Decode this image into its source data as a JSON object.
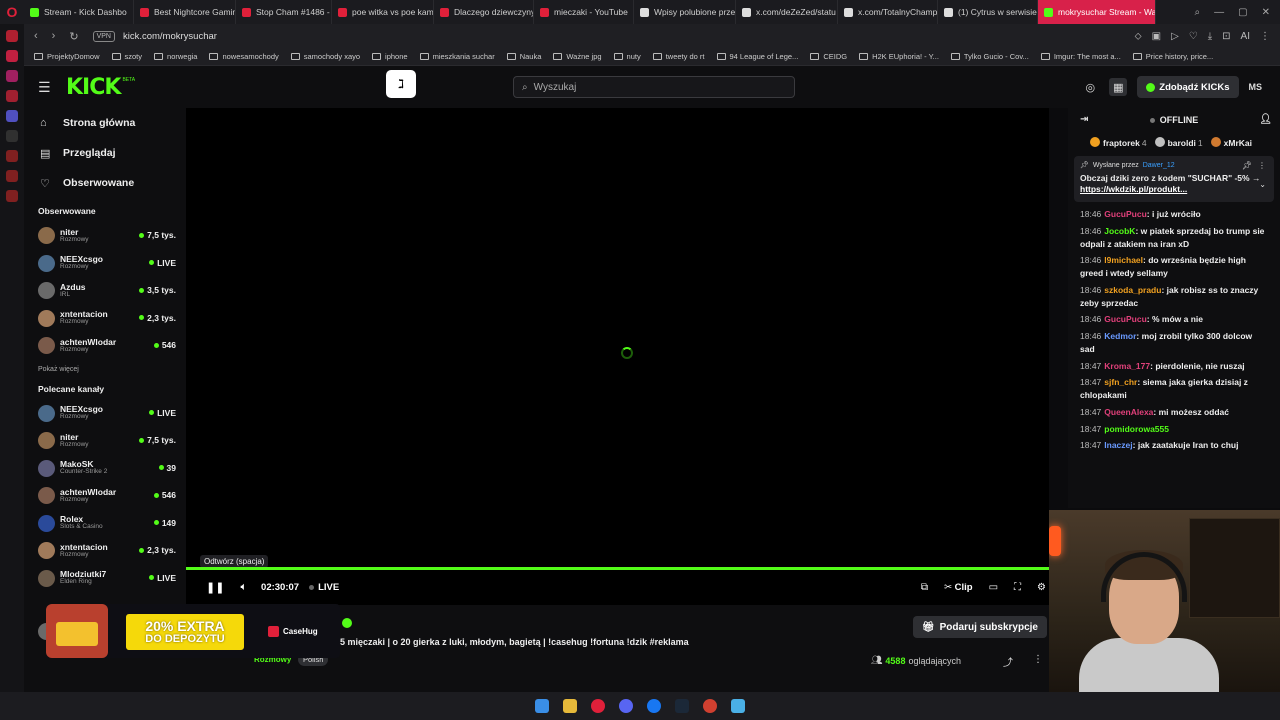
{
  "browser": {
    "tabs": [
      {
        "label": "Stream - Kick Dashbo",
        "color": "#53fc18"
      },
      {
        "label": "Best Nightcore Gamin",
        "color": "#e0203a"
      },
      {
        "label": "Stop Cham #1486 - N",
        "color": "#e0203a"
      },
      {
        "label": "poe witka vs poe kam",
        "color": "#e0203a"
      },
      {
        "label": "Dlaczego dziewczyny",
        "color": "#e0203a"
      },
      {
        "label": "mieczaki - YouTube",
        "color": "#e0203a"
      },
      {
        "label": "Wpisy polubione prze",
        "color": "#dddddd"
      },
      {
        "label": "x.com/deZeZed/statu",
        "color": "#dddddd"
      },
      {
        "label": "x.com/TotalnyChamp",
        "color": "#dddddd"
      },
      {
        "label": "(1) Cytrus w serwisie",
        "color": "#dddddd"
      },
      {
        "label": "mokrysuchar Stream - Wat",
        "color": "#53fc18"
      }
    ],
    "url": "kick.com/mokrysuchar",
    "vpn_label": "VPN",
    "ai_label": "AI",
    "bookmarks": [
      "ProjektyDomow",
      "szoty",
      "norwegia",
      "nowesamochody",
      "samochody xayo",
      "iphone",
      "mieszkania suchar",
      "Nauka",
      "Ważne jpg",
      "nuty",
      "tweety do rt",
      "94 League of Lege...",
      "CEIDG",
      "H2K EUphoria! - Y...",
      "Tylko Gucio - Cov...",
      "Imgur: The most a...",
      "Price history, price..."
    ]
  },
  "header": {
    "logo": "KICK",
    "beta": "BETA",
    "ext_icon": "ℷ",
    "search_placeholder": "Wyszukaj",
    "kicks_button": "Zdobądź KICKs",
    "avatar": "MS"
  },
  "sidebar": {
    "nav": [
      {
        "label": "Strona główna",
        "icon": "home-icon"
      },
      {
        "label": "Przeglądaj",
        "icon": "browse-icon"
      },
      {
        "label": "Obserwowane",
        "icon": "heart-icon"
      }
    ],
    "followed_title": "Obserwowane",
    "followed": [
      {
        "name": "niter",
        "category": "Rozmowy",
        "viewers": "7,5 tys.",
        "color": "#8a6a4a"
      },
      {
        "name": "NEEXcsgo",
        "category": "Rozmowy",
        "viewers": "LIVE",
        "color": "#4a6a8a"
      },
      {
        "name": "Azdus",
        "category": "IRL",
        "viewers": "3,5 tys.",
        "color": "#6a6a6a"
      },
      {
        "name": "xntentacion",
        "category": "Rozmowy",
        "viewers": "2,3 tys.",
        "color": "#a07a5a"
      },
      {
        "name": "achtenWlodar",
        "category": "Rozmowy",
        "viewers": "546",
        "color": "#7a5a4a"
      }
    ],
    "show_more": "Pokaż więcej",
    "recommended_title": "Polecane kanały",
    "recommended": [
      {
        "name": "NEEXcsgo",
        "category": "Rozmowy",
        "viewers": "LIVE",
        "color": "#4a6a8a"
      },
      {
        "name": "niter",
        "category": "Rozmowy",
        "viewers": "7,5 tys.",
        "color": "#8a6a4a"
      },
      {
        "name": "MakoSK",
        "category": "Counter-Strike 2",
        "viewers": "39",
        "color": "#5a5a7a"
      },
      {
        "name": "achtenWlodar",
        "category": "Rozmowy",
        "viewers": "546",
        "color": "#7a5a4a"
      },
      {
        "name": "Rolex",
        "category": "Slots & Casino",
        "viewers": "149",
        "color": "#2a4a9a"
      },
      {
        "name": "xntentacion",
        "category": "Rozmowy",
        "viewers": "2,3 tys.",
        "color": "#a07a5a"
      },
      {
        "name": "Mlodziutki7",
        "category": "Elden Ring",
        "viewers": "LIVE",
        "color": "#6a5a4a"
      }
    ],
    "extra": [
      {
        "name": "Azdus",
        "category": "IRL",
        "viewers": "3,5 tys.",
        "color": "#6a6a6a"
      }
    ]
  },
  "player": {
    "tooltip": "Odtwórz (spacja)",
    "time": "02:30:07",
    "live_label": "LIVE",
    "clip_label": "Clip",
    "progress": 1.0
  },
  "stream": {
    "title": "5 mięczaki | o 20 gierka z luki, młodym, bagietą | !casehug !fortuna !dzik #reklama",
    "category": "Rozmowy",
    "language": "Polish",
    "subscribe": "Podaruj subskrypcje",
    "viewers_count": "4588",
    "viewers_label": "oglądających"
  },
  "ad": {
    "bonus_big": "20% EXTRA",
    "bonus_small": "DO DEPOZYTU",
    "brand": "CaseHug"
  },
  "chat": {
    "status": "OFFLINE",
    "leaderboard": [
      {
        "name": "fraptorek",
        "count": "4",
        "color": "#f0a020"
      },
      {
        "name": "baroldi",
        "count": "1",
        "color": "#c0c0c0"
      },
      {
        "name": "xMrKai",
        "count": "",
        "color": "#d07a30"
      }
    ],
    "pinned": {
      "label": "Wysłane przez",
      "by": "Dawer_12",
      "text": "Obczaj dziki zero z kodem \"SUCHAR\" -5%",
      "arrow": "→",
      "link": "https://wkdzik.pl/produkt..."
    },
    "messages": [
      {
        "time": "18:46",
        "user": "GucuPucu",
        "color": "#e0407a",
        "text": "i już wróciło"
      },
      {
        "time": "18:46",
        "user": "JocobK",
        "color": "#53fc18",
        "text": "w piatek sprzedaj bo trump sie odpali z atakiem na iran xD"
      },
      {
        "time": "18:46",
        "user": "l9michael",
        "color": "#f0a020",
        "text": "do września będzie high greed i wtedy sellamy"
      },
      {
        "time": "18:46",
        "user": "szkoda_pradu",
        "color": "#f0a020",
        "text": "jak robisz ss to znaczy zeby sprzedac"
      },
      {
        "time": "18:46",
        "user": "GucuPucu",
        "color": "#e0407a",
        "text": "% mów a nie"
      },
      {
        "time": "18:46",
        "user": "Kedmor",
        "color": "#6a9aff",
        "text": "moj zrobil tylko 300 dolcow sad"
      },
      {
        "time": "18:47",
        "user": "Kroma_177",
        "color": "#e0407a",
        "text": "pierdolenie, nie ruszaj"
      },
      {
        "time": "18:47",
        "user": "sjfn_chr",
        "color": "#f0a020",
        "text": "siema jaka gierka dzisiaj z chlopakami"
      },
      {
        "time": "18:47",
        "user": "QueenAlexa",
        "color": "#e0407a",
        "text": "mi możesz oddać"
      },
      {
        "time": "18:47",
        "user": "pomidorowa555",
        "color": "#53fc18",
        "text": ""
      },
      {
        "time": "18:47",
        "user": "Inaczej",
        "color": "#6a9aff",
        "text": "jak zaatakuje Iran to chuj"
      }
    ]
  }
}
